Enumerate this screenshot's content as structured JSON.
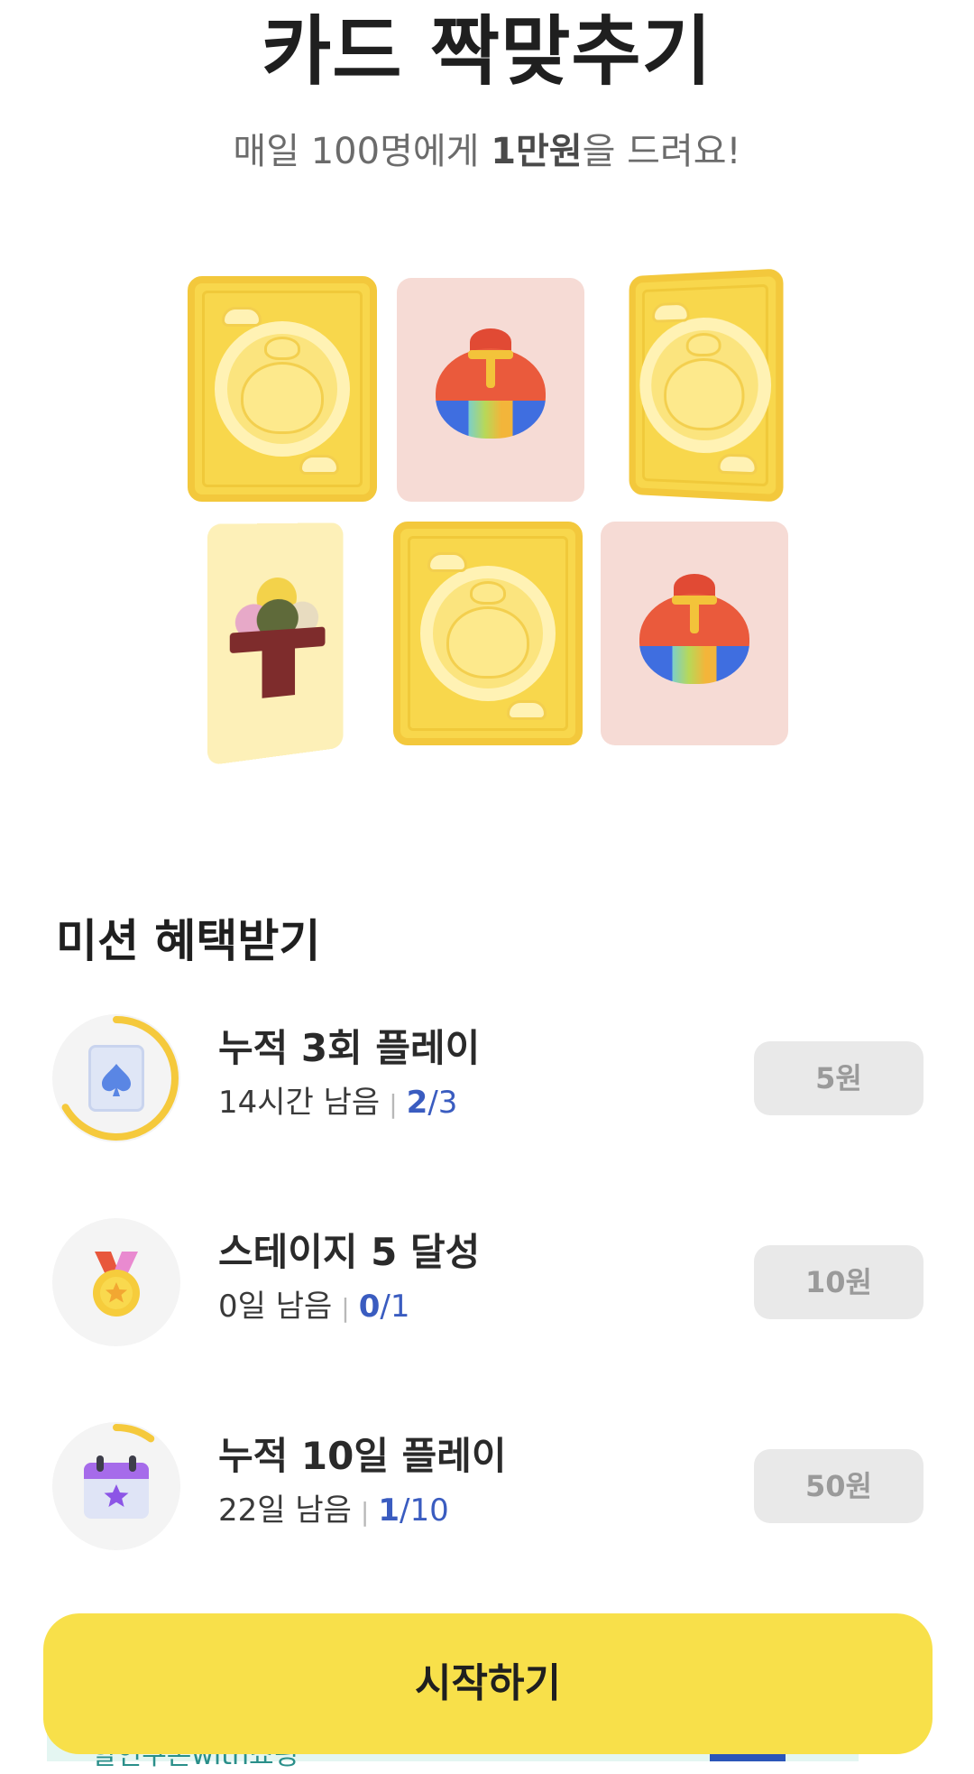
{
  "header": {
    "title": "카드 짝맞추기",
    "subtitle_pre": "매일 100명에게 ",
    "subtitle_bold": "1만원",
    "subtitle_post": "을 드려요!"
  },
  "cards": [
    {
      "type": "back",
      "icon": "chick-moon-icon"
    },
    {
      "type": "face",
      "icon": "lucky-pouch-icon"
    },
    {
      "type": "back",
      "icon": "chick-moon-icon"
    },
    {
      "type": "face",
      "icon": "rice-cake-icon"
    },
    {
      "type": "back",
      "icon": "chick-moon-icon"
    },
    {
      "type": "face",
      "icon": "lucky-pouch-icon"
    }
  ],
  "missions": {
    "title": "미션 혜택받기",
    "items": [
      {
        "name": "누적 3회 플레이",
        "remaining": "14시간 남음",
        "current": "2",
        "total": "/3",
        "reward": "5원",
        "icon": "spade-card-icon",
        "progress": 0.667
      },
      {
        "name": "스테이지 5 달성",
        "remaining": "0일 남음",
        "current": "0",
        "total": "/1",
        "reward": "10원",
        "icon": "medal-icon",
        "progress": 0
      },
      {
        "name": "누적 10일 플레이",
        "remaining": "22일 남음",
        "current": "1",
        "total": "/10",
        "reward": "50원",
        "icon": "calendar-star-icon",
        "progress": 0.1
      }
    ]
  },
  "actions": {
    "start_label": "시작하기"
  },
  "banner": {
    "partial_text": "할인쿠폰with쇼핑"
  },
  "colors": {
    "accent_yellow": "#f8e04a",
    "progress_ring": "#f5c93c",
    "count_blue": "#3a5cc0",
    "reward_bg": "#e9e9e9"
  }
}
